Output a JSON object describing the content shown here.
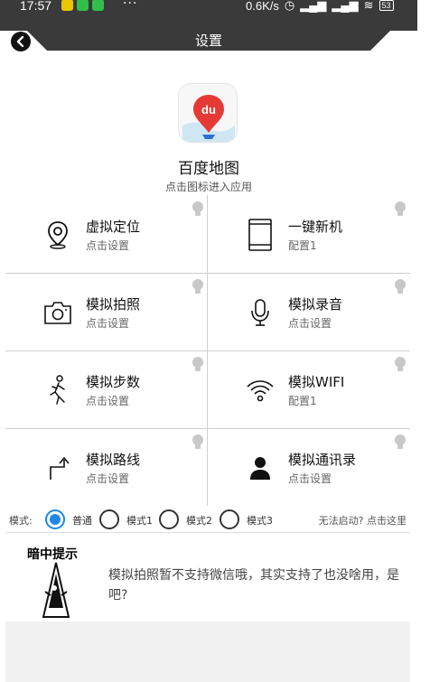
{
  "status_bar": {
    "time": "17:57",
    "more": "···",
    "net_speed": "0.6K/s",
    "battery": "53"
  },
  "header": {
    "title": "设置",
    "back_icon": "back-arrow-icon"
  },
  "app": {
    "name": "百度地图",
    "icon_text": "du",
    "hint": "点击图标进入应用"
  },
  "features": [
    {
      "name": "虚拟定位",
      "sub": "点击设置",
      "icon": "location-pin-icon"
    },
    {
      "name": "一键新机",
      "sub": "配置1",
      "icon": "phone-icon"
    },
    {
      "name": "模拟拍照",
      "sub": "点击设置",
      "icon": "camera-icon"
    },
    {
      "name": "模拟录音",
      "sub": "点击设置",
      "icon": "microphone-icon"
    },
    {
      "name": "模拟步数",
      "sub": "点击设置",
      "icon": "walking-icon"
    },
    {
      "name": "模拟WIFI",
      "sub": "配置1",
      "icon": "wifi-icon"
    },
    {
      "name": "模拟路线",
      "sub": "点击设置",
      "icon": "route-icon"
    },
    {
      "name": "模拟通讯录",
      "sub": "点击设置",
      "icon": "contact-icon"
    }
  ],
  "mode": {
    "label": "模式:",
    "options": [
      "普通",
      "模式1",
      "模式2",
      "模式3"
    ],
    "selected": "普通",
    "help": "无法启动? 点击这里"
  },
  "tip": {
    "title": "暗中提示",
    "text": "模拟拍照暂不支持微信哦，其实支持了也没啥用，是吧?"
  },
  "colors": {
    "accent": "#1e88e5",
    "header": "#3a3a3a",
    "app_red": "#e53935"
  }
}
